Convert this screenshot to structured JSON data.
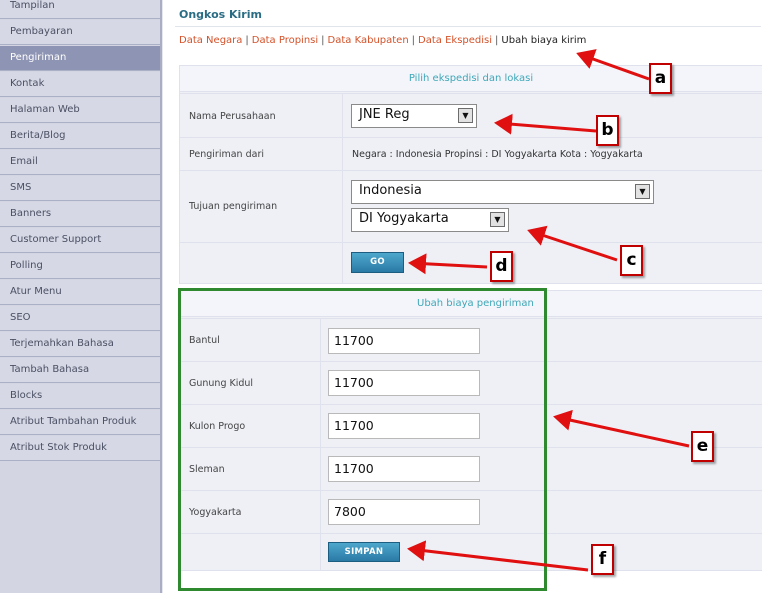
{
  "sidebar": {
    "items": [
      {
        "label": "Tampilan",
        "active": false
      },
      {
        "label": "Pembayaran",
        "active": false
      },
      {
        "label": "Pengiriman",
        "active": true
      },
      {
        "label": "Kontak",
        "active": false
      },
      {
        "label": "Halaman Web",
        "active": false
      },
      {
        "label": "Berita/Blog",
        "active": false
      },
      {
        "label": "Email",
        "active": false
      },
      {
        "label": "SMS",
        "active": false
      },
      {
        "label": "Banners",
        "active": false
      },
      {
        "label": "Customer Support",
        "active": false
      },
      {
        "label": "Polling",
        "active": false
      },
      {
        "label": "Atur Menu",
        "active": false
      },
      {
        "label": "SEO",
        "active": false
      },
      {
        "label": "Terjemahkan Bahasa",
        "active": false
      },
      {
        "label": "Tambah Bahasa",
        "active": false
      },
      {
        "label": "Blocks",
        "active": false
      },
      {
        "label": "Atribut Tambahan Produk",
        "active": false
      },
      {
        "label": "Atribut Stok Produk",
        "active": false
      }
    ]
  },
  "page": {
    "title": "Ongkos Kirim",
    "breadcrumb": {
      "links": [
        "Data Negara",
        "Data Propinsi",
        "Data Kabupaten",
        "Data Ekspedisi"
      ],
      "separator": "|",
      "current": "Ubah biaya kirim"
    }
  },
  "select_panel": {
    "heading": "Pilih ekspedisi dan lokasi",
    "company_label": "Nama Perusahaan",
    "company_value": "JNE Reg",
    "origin_label": "Pengiriman dari",
    "origin_text": "Negara : Indonesia    Propinsi : DI Yogyakarta    Kota : Yogyakarta",
    "destination_label": "Tujuan pengiriman",
    "country_value": "Indonesia",
    "province_value": "DI Yogyakarta",
    "go_label": "GO"
  },
  "cost_panel": {
    "heading": "Ubah biaya pengiriman",
    "rows": [
      {
        "city": "Bantul",
        "cost": "11700"
      },
      {
        "city": "Gunung Kidul",
        "cost": "11700"
      },
      {
        "city": "Kulon Progo",
        "cost": "11700"
      },
      {
        "city": "Sleman",
        "cost": "11700"
      },
      {
        "city": "Yogyakarta",
        "cost": "7800"
      }
    ],
    "save_label": "SIMPAN"
  },
  "annotations": {
    "labels": [
      "a",
      "b",
      "c",
      "d",
      "e",
      "f"
    ],
    "arrow_color": "#e01010",
    "box_color": "#2f8a2f"
  },
  "colors": {
    "link": "#d4522a",
    "title": "#2a6c84",
    "panel_heading": "#3fa7b8",
    "button": "#2a7aa6",
    "sidebar_active": "#8e94b3"
  }
}
